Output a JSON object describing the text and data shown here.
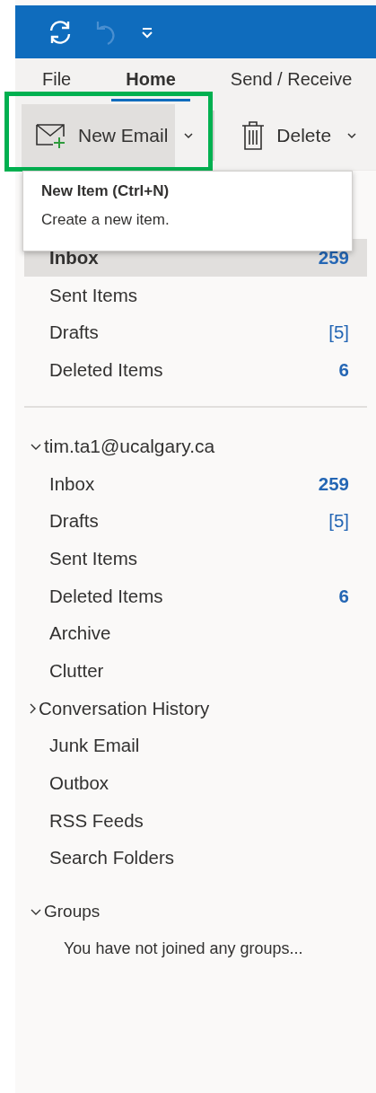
{
  "quick_access": [
    {
      "kind": "sync",
      "disabled": false
    },
    {
      "kind": "undo",
      "disabled": true
    },
    {
      "kind": "customize",
      "disabled": false
    }
  ],
  "tabs": [
    {
      "label": "File",
      "selected": false
    },
    {
      "label": "Home",
      "selected": true
    },
    {
      "label": "Send / Receive",
      "selected": false
    }
  ],
  "toolbar": [
    {
      "kind": "new_email",
      "label": "New Email",
      "highlighted": true
    },
    {
      "kind": "delete",
      "label": "Delete",
      "highlighted": false
    }
  ],
  "tooltip": {
    "title": "New Item (Ctrl+N)",
    "description": "Create a new item."
  },
  "favorites": [
    {
      "name": "Inbox",
      "selected": true,
      "count": {
        "text": "259",
        "kind": "unread"
      }
    },
    {
      "name": "Sent Items",
      "selected": false
    },
    {
      "name": "Drafts",
      "selected": false,
      "count": {
        "text": "[5]",
        "kind": "total"
      }
    },
    {
      "name": "Deleted Items",
      "selected": false,
      "count": {
        "text": "6",
        "kind": "unread"
      }
    }
  ],
  "account": {
    "name": "tim.ta1@ucalgary.ca",
    "expanded": true,
    "folders": [
      {
        "name": "Inbox",
        "selected": false,
        "count": {
          "text": "259",
          "kind": "unread"
        }
      },
      {
        "name": "Drafts",
        "selected": false,
        "count": {
          "text": "[5]",
          "kind": "total"
        }
      },
      {
        "name": "Sent Items",
        "selected": false
      },
      {
        "name": "Deleted Items",
        "selected": false,
        "count": {
          "text": "6",
          "kind": "unread"
        }
      },
      {
        "name": "Archive",
        "selected": false
      },
      {
        "name": "Clutter",
        "selected": false
      },
      {
        "name": "Conversation History",
        "selected": false,
        "expanded": false
      },
      {
        "name": "Junk Email",
        "selected": false
      },
      {
        "name": "Outbox",
        "selected": false
      },
      {
        "name": "RSS Feeds",
        "selected": false
      },
      {
        "name": "Search Folders",
        "selected": false
      }
    ]
  },
  "groups": {
    "name": "Groups",
    "expanded": true,
    "note": "You have not joined any groups..."
  }
}
